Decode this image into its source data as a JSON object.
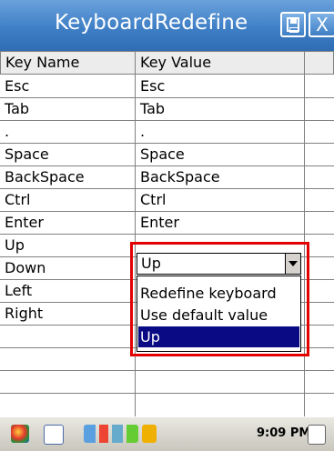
{
  "window": {
    "title": "KeyboardRedefine",
    "save_icon": "save-icon",
    "close_label": "X"
  },
  "table": {
    "headers": [
      "Key Name",
      "Key Value"
    ],
    "rows": [
      {
        "name": "Esc",
        "value": "Esc"
      },
      {
        "name": "Tab",
        "value": "Tab"
      },
      {
        "name": ".",
        "value": "."
      },
      {
        "name": "Space",
        "value": "Space"
      },
      {
        "name": "BackSpace",
        "value": "BackSpace"
      },
      {
        "name": "Ctrl",
        "value": "Ctrl"
      },
      {
        "name": "Enter",
        "value": "Enter"
      },
      {
        "name": "Up",
        "value": ""
      },
      {
        "name": "Down",
        "value": ""
      },
      {
        "name": "Left",
        "value": ""
      },
      {
        "name": "Right",
        "value": ""
      }
    ]
  },
  "dropdown": {
    "selected": "Up",
    "options": [
      "Redefine keyboard",
      "Use default value",
      "Up"
    ],
    "highlighted_option": "Up",
    "highlight_color": "#e20000"
  },
  "taskbar": {
    "clock": "9:09 PM"
  },
  "colors": {
    "title_bar": "#3f7fc6",
    "selection": "#0a0a84"
  }
}
